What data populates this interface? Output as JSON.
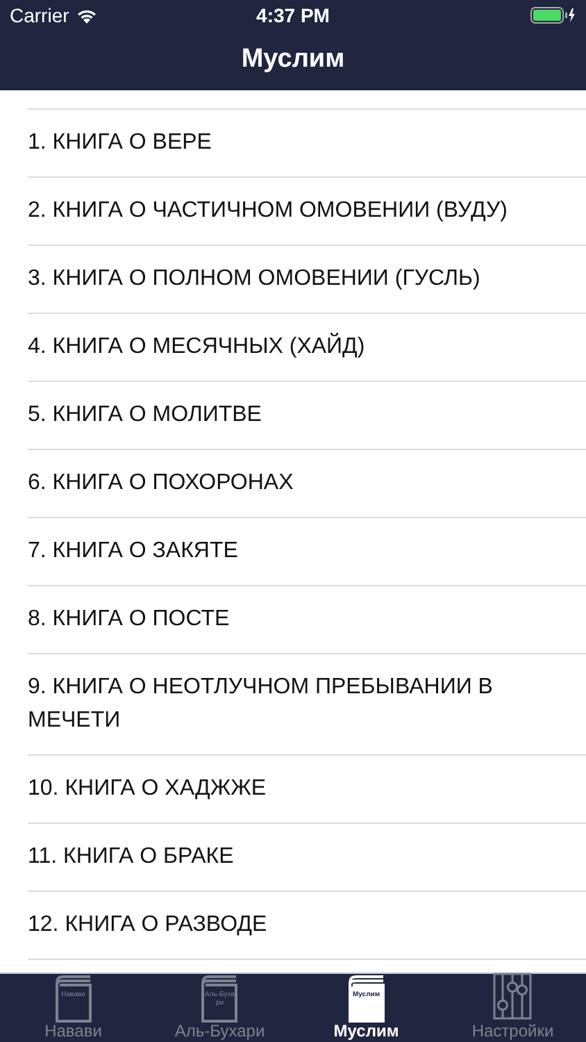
{
  "status_bar": {
    "carrier": "Carrier",
    "time": "4:37 PM"
  },
  "nav_bar": {
    "title": "Муслим"
  },
  "list": [
    {
      "label": "1. КНИГА О ВЕРЕ"
    },
    {
      "label": "2. КНИГА О ЧАСТИЧНОМ ОМОВЕНИИ (ВУДУ)"
    },
    {
      "label": "3. КНИГА О ПОЛНОМ ОМОВЕНИИ (ГУСЛЬ)"
    },
    {
      "label": "4. КНИГА О МЕСЯЧНЫХ (ХАЙД)"
    },
    {
      "label": "5. КНИГА О МОЛИТВЕ"
    },
    {
      "label": "6. КНИГА О ПОХОРОНАХ"
    },
    {
      "label": "7. КНИГА О ЗАКЯТЕ"
    },
    {
      "label": "8. КНИГА О ПОСТЕ"
    },
    {
      "label": "9. КНИГА О НЕОТЛУЧНОМ ПРЕБЫВАНИИ В МЕЧЕТИ"
    },
    {
      "label": "10. КНИГА О ХАДЖЖЕ"
    },
    {
      "label": "11. КНИГА О БРАКЕ"
    },
    {
      "label": "12. КНИГА О РАЗВОДЕ"
    }
  ],
  "tab_bar": [
    {
      "kind": "book",
      "icon_text": "Навави",
      "label": "Навави",
      "selected": false
    },
    {
      "kind": "book",
      "icon_text": "Аль-Бухари",
      "label": "Аль-Бухари",
      "selected": false
    },
    {
      "kind": "book",
      "icon_text": "Муслим",
      "label": "Муслим",
      "selected": true
    },
    {
      "kind": "sliders",
      "label": "Настройки",
      "selected": false
    }
  ]
}
